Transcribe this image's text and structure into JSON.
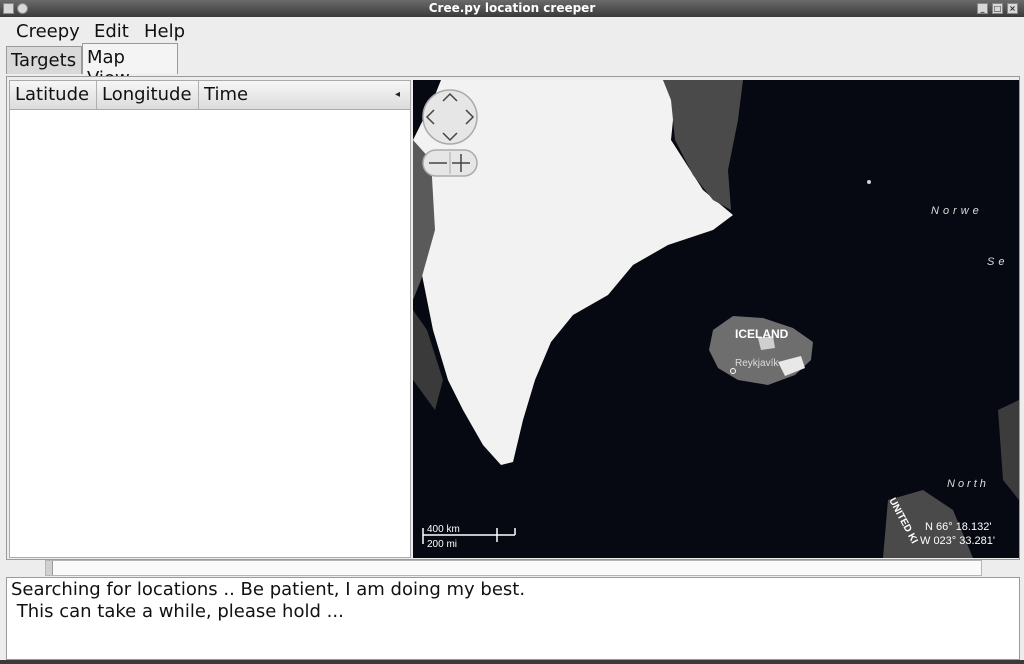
{
  "window": {
    "title": "Cree.py location creeper"
  },
  "menubar": {
    "items": [
      "Creepy",
      "Edit",
      "Help"
    ]
  },
  "tabs": {
    "targets": "Targets",
    "map_view": "Map View"
  },
  "table": {
    "columns": [
      "Latitude",
      "Longitude",
      "Time"
    ],
    "rows": []
  },
  "map": {
    "country_label": "ICELAND",
    "city_label": "Reykjavík",
    "sea_label_1": "Norwe",
    "sea_label_2": "Se",
    "north_label": "North",
    "country_label_2": "UNITED KI",
    "scale_km": "400 km",
    "scale_mi": "200 mi",
    "coord_lat": "N 66° 18.132'",
    "coord_lon": "W 023° 33.281'"
  },
  "log": {
    "line1": "Searching for locations .. Be patient, I am doing my best.",
    "line2": " This can take a while, please hold ..."
  },
  "colors": {
    "map_sea": "#060812",
    "ice": "#f2f2f2",
    "land": "#6e6e6e"
  }
}
